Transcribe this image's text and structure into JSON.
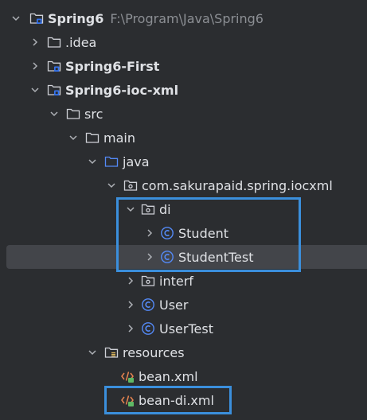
{
  "tree": {
    "root": {
      "label": "Spring6",
      "path": "F:\\Program\\Java\\Spring6"
    },
    "idea": {
      "label": ".idea"
    },
    "first": {
      "label": "Spring6-First"
    },
    "iocxml": {
      "label": "Spring6-ioc-xml"
    },
    "src": {
      "label": "src"
    },
    "main": {
      "label": "main"
    },
    "java": {
      "label": "java"
    },
    "pkg": {
      "label": "com.sakurapaid.spring.iocxml"
    },
    "di": {
      "label": "di"
    },
    "student": {
      "label": "Student"
    },
    "studentTest": {
      "label": "StudentTest"
    },
    "interf": {
      "label": "interf"
    },
    "user": {
      "label": "User"
    },
    "userTest": {
      "label": "UserTest"
    },
    "resources": {
      "label": "resources"
    },
    "beanXml": {
      "label": "bean.xml"
    },
    "beanDiXml": {
      "label": "bean-di.xml"
    }
  },
  "icons": {
    "chevron": "chevron-icon",
    "module": "module-folder-icon",
    "folder": "folder-icon",
    "sourceFolder": "source-folder-icon",
    "package": "package-icon",
    "class": "java-class-icon",
    "resources": "resources-folder-icon",
    "xml": "xml-file-icon"
  },
  "colors": {
    "background": "#2b2d30",
    "selection": "#43454a",
    "text": "#dfe1e5",
    "pathText": "#8c8f94",
    "highlightBox": "#3b8fdc",
    "classIcon": "#548af7",
    "sourceFolder": "#548af7",
    "xmlIcon": "#e8844f"
  }
}
